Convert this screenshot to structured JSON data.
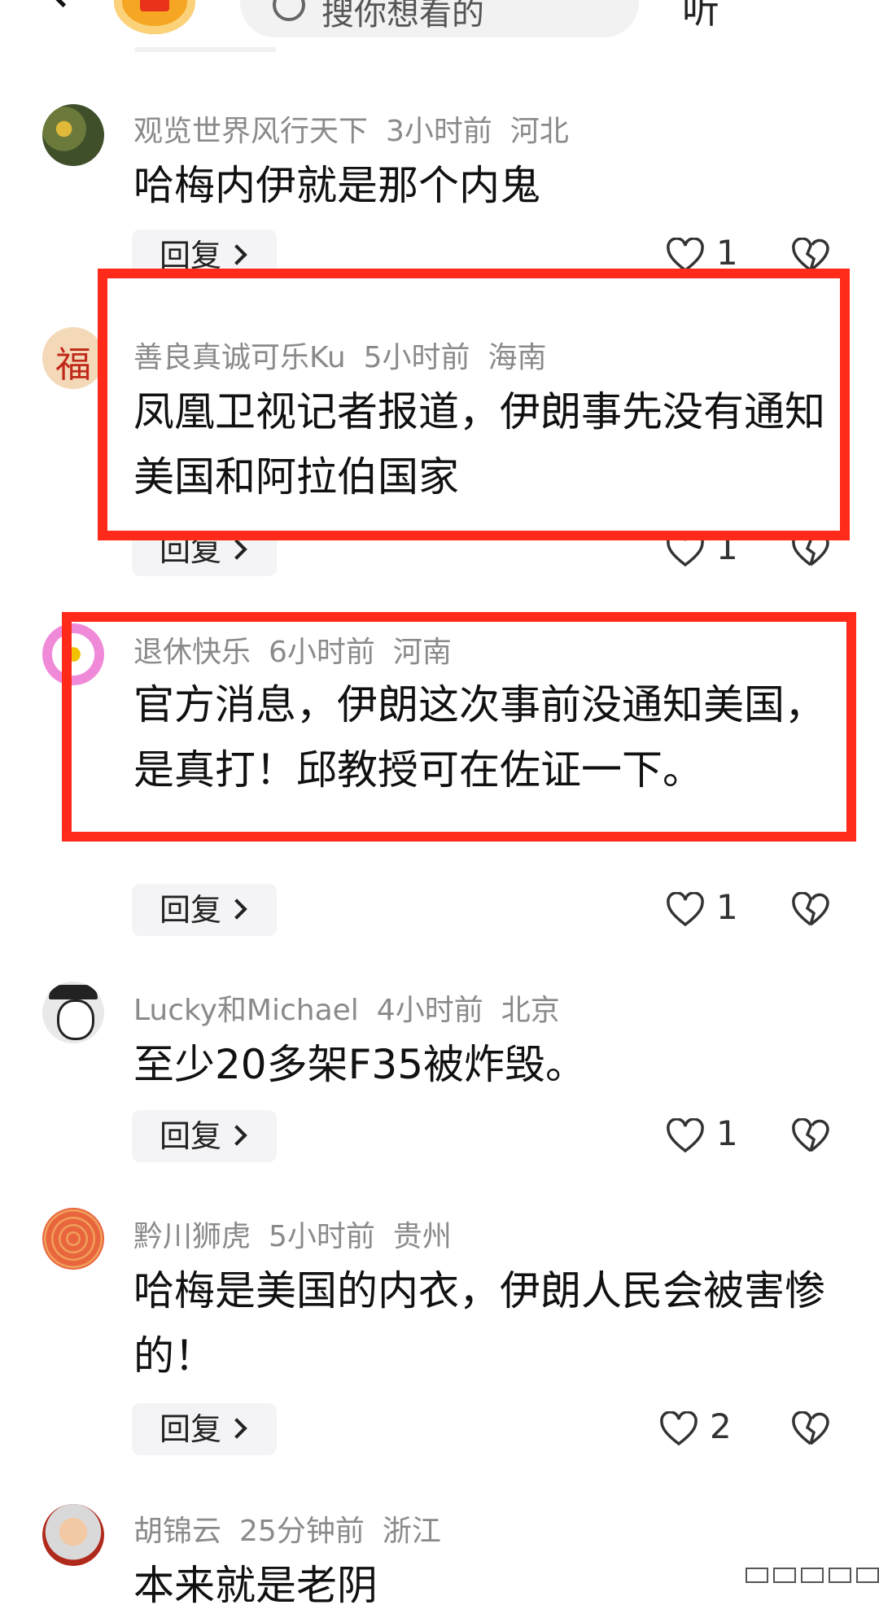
{
  "header": {
    "search_placeholder": "搜你想看的",
    "listen_label": "听"
  },
  "comments": [
    {
      "user": "观览世界风行天下",
      "time": "3小时前",
      "location": "河北",
      "text": "哈梅内伊就是那个内鬼",
      "reply": "回复",
      "likes": "1"
    },
    {
      "user": "善良真诚可乐Ku",
      "time": "5小时前",
      "location": "海南",
      "text": "凤凰卫视记者报道，伊朗事先没有通知美国和阿拉伯国家",
      "reply": "回复",
      "likes": "1"
    },
    {
      "user": "退休快乐",
      "time": "6小时前",
      "location": "河南",
      "text": "官方消息，伊朗这次事前没通知美国，是真打！邱教授可在佐证一下。",
      "reply": "回复",
      "likes": "1"
    },
    {
      "user": "Lucky和Michael",
      "time": "4小时前",
      "location": "北京",
      "text": "至少20多架F35被炸毁。",
      "reply": "回复",
      "likes": "1"
    },
    {
      "user": "黔川狮虎",
      "time": "5小时前",
      "location": "贵州",
      "text": "哈梅是美国的内衣，伊朗人民会被害惨的！",
      "reply": "回复",
      "likes": "2"
    },
    {
      "user": "胡锦云",
      "time": "25分钟前",
      "location": "浙江",
      "text": "本来就是老阴"
    }
  ],
  "colors": {
    "highlight": "#ff2a1a",
    "meta": "#8a8a8a"
  }
}
